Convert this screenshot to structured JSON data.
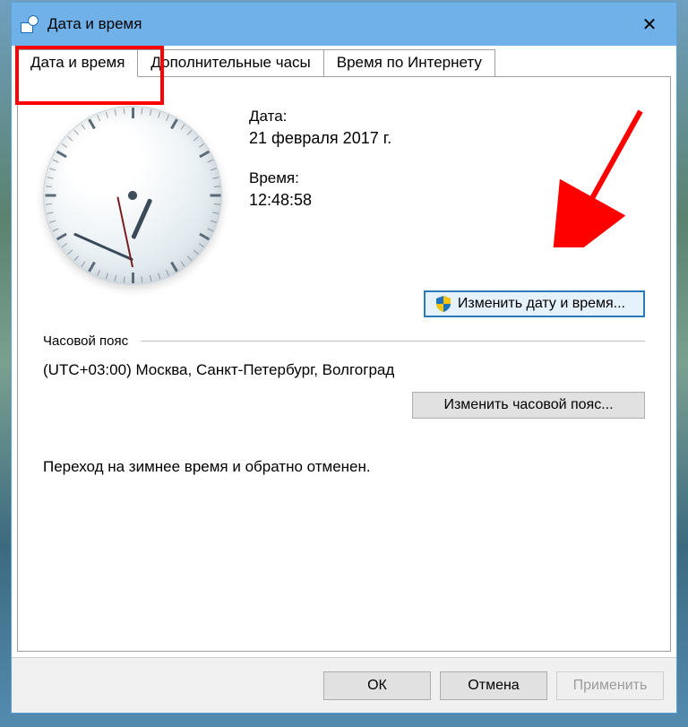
{
  "window": {
    "title": "Дата и время"
  },
  "tabs": {
    "t0": "Дата и время",
    "t1": "Дополнительные часы",
    "t2": "Время по Интернету"
  },
  "datetime": {
    "date_label": "Дата:",
    "date_value": "21 февраля 2017 г.",
    "time_label": "Время:",
    "time_value": "12:48:58",
    "change_button": "Изменить дату и время..."
  },
  "clock": {
    "hours": 12,
    "minutes": 48,
    "seconds": 58
  },
  "timezone": {
    "section_label": "Часовой пояс",
    "value": "(UTC+03:00) Москва, Санкт-Петербург, Волгоград",
    "change_button": "Изменить часовой пояс..."
  },
  "dst_note": "Переход на зимнее время и обратно отменен.",
  "footer": {
    "ok": "ОК",
    "cancel": "Отмена",
    "apply": "Применить"
  }
}
